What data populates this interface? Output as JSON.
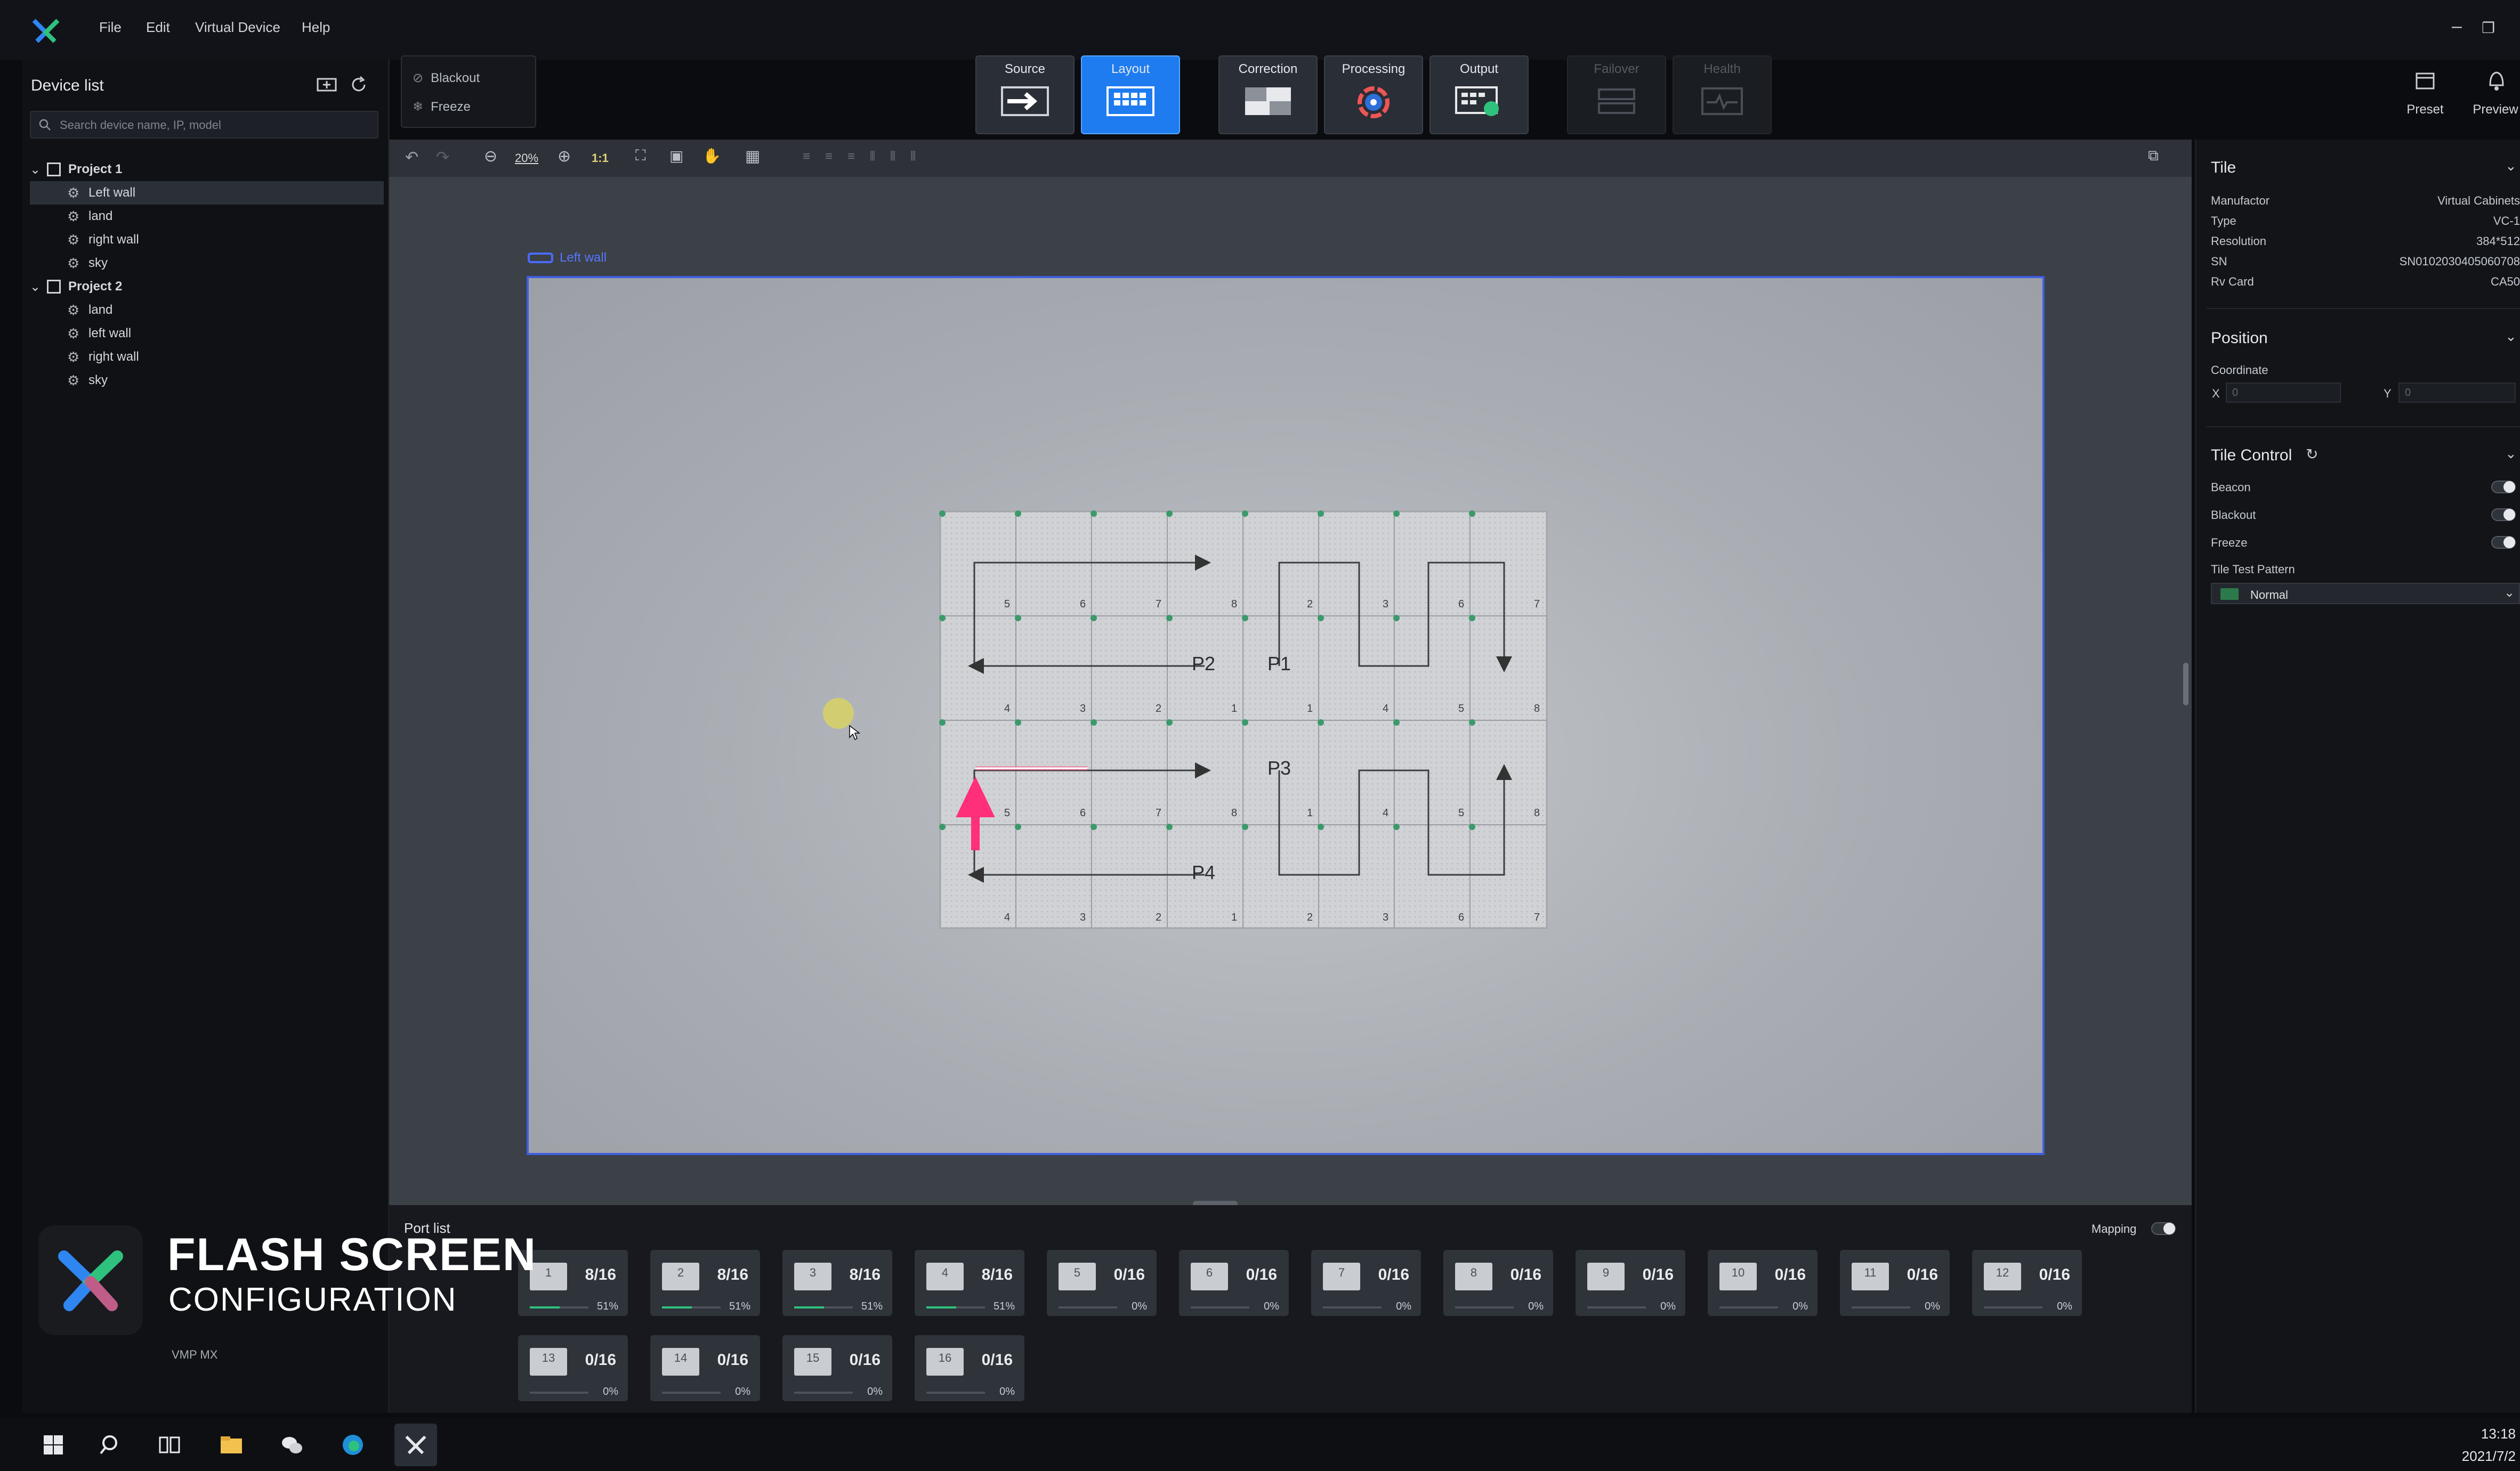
{
  "menu": {
    "items": [
      "File",
      "Edit",
      "Virtual Device",
      "Help"
    ]
  },
  "controls": {
    "blackout": "Blackout",
    "freeze": "Freeze"
  },
  "workflow": [
    {
      "label": "Source",
      "state": "normal"
    },
    {
      "label": "Layout",
      "state": "active"
    },
    {
      "label": "Correction",
      "state": "normal"
    },
    {
      "label": "Processing",
      "state": "normal"
    },
    {
      "label": "Output",
      "state": "normal"
    },
    {
      "label": "Failover",
      "state": "disabled"
    },
    {
      "label": "Health",
      "state": "disabled"
    }
  ],
  "top_right": {
    "preset": "Preset",
    "preview": "Preview"
  },
  "device_list": {
    "title": "Device list",
    "search_placeholder": "Search device name, IP, model",
    "projects": [
      {
        "name": "Project 1",
        "children": [
          "Left wall",
          "land",
          "right wall",
          "sky"
        ]
      },
      {
        "name": "Project 2",
        "children": [
          "land",
          "left wall",
          "right wall",
          "sky"
        ]
      }
    ],
    "selected": "Left wall"
  },
  "canvas_toolbar": {
    "zoom": "20%",
    "ratio": "1:1"
  },
  "canvas": {
    "screen_label": "Left wall",
    "receivers": [
      "P1",
      "P2",
      "P3",
      "P4"
    ],
    "cell_numbers": [
      [
        "5",
        "6",
        "7",
        "8",
        "2",
        "3",
        "6",
        "7"
      ],
      [
        "4",
        "3",
        "2",
        "1",
        "1",
        "4",
        "5",
        "8"
      ],
      [
        "5",
        "6",
        "7",
        "8",
        "1",
        "4",
        "5",
        "8"
      ],
      [
        "4",
        "3",
        "2",
        "1",
        "2",
        "3",
        "6",
        "7"
      ]
    ]
  },
  "tile": {
    "title": "Tile",
    "manufactor_label": "Manufactor",
    "manufactor": "Virtual Cabinets",
    "type_label": "Type",
    "type": "VC-1",
    "resolution_label": "Resolution",
    "resolution": "384*512",
    "sn_label": "SN",
    "sn": "SN0102030405060708",
    "rvcard_label": "Rv Card",
    "rvcard": "CA50"
  },
  "position": {
    "title": "Position",
    "coordinate": "Coordinate",
    "x_label": "X",
    "y_label": "Y",
    "x": "0",
    "y": "0"
  },
  "tile_control": {
    "title": "Tile Control",
    "beacon": "Beacon",
    "blackout": "Blackout",
    "freeze": "Freeze",
    "pattern_label": "Tile Test Pattern",
    "pattern": "Normal"
  },
  "port_list": {
    "title": "Port list",
    "mapping": "Mapping",
    "ports": [
      {
        "n": "1",
        "count": "8/16",
        "pct": "51%",
        "fill": 0.51
      },
      {
        "n": "2",
        "count": "8/16",
        "pct": "51%",
        "fill": 0.51
      },
      {
        "n": "3",
        "count": "8/16",
        "pct": "51%",
        "fill": 0.51
      },
      {
        "n": "4",
        "count": "8/16",
        "pct": "51%",
        "fill": 0.51
      },
      {
        "n": "5",
        "count": "0/16",
        "pct": "0%",
        "fill": 0
      },
      {
        "n": "6",
        "count": "0/16",
        "pct": "0%",
        "fill": 0
      },
      {
        "n": "7",
        "count": "0/16",
        "pct": "0%",
        "fill": 0
      },
      {
        "n": "8",
        "count": "0/16",
        "pct": "0%",
        "fill": 0
      },
      {
        "n": "9",
        "count": "0/16",
        "pct": "0%",
        "fill": 0
      },
      {
        "n": "10",
        "count": "0/16",
        "pct": "0%",
        "fill": 0
      },
      {
        "n": "11",
        "count": "0/16",
        "pct": "0%",
        "fill": 0
      },
      {
        "n": "12",
        "count": "0/16",
        "pct": "0%",
        "fill": 0
      },
      {
        "n": "13",
        "count": "0/16",
        "pct": "0%",
        "fill": 0
      },
      {
        "n": "14",
        "count": "0/16",
        "pct": "0%",
        "fill": 0
      },
      {
        "n": "15",
        "count": "0/16",
        "pct": "0%",
        "fill": 0
      },
      {
        "n": "16",
        "count": "0/16",
        "pct": "0%",
        "fill": 0
      }
    ]
  },
  "banner": {
    "line1": "FLASH SCREEN",
    "line2": "CONFIGURATION",
    "product": "VMP MX"
  },
  "taskbar": {
    "time": "13:18",
    "date": "2021/7/2"
  },
  "colors": {
    "accent": "#1e7cf0",
    "pink_arrow": "#ff2f7a",
    "green_dot": "#3b9a6a",
    "logo_blue": "#2f86f0",
    "logo_green": "#2ec27e"
  }
}
